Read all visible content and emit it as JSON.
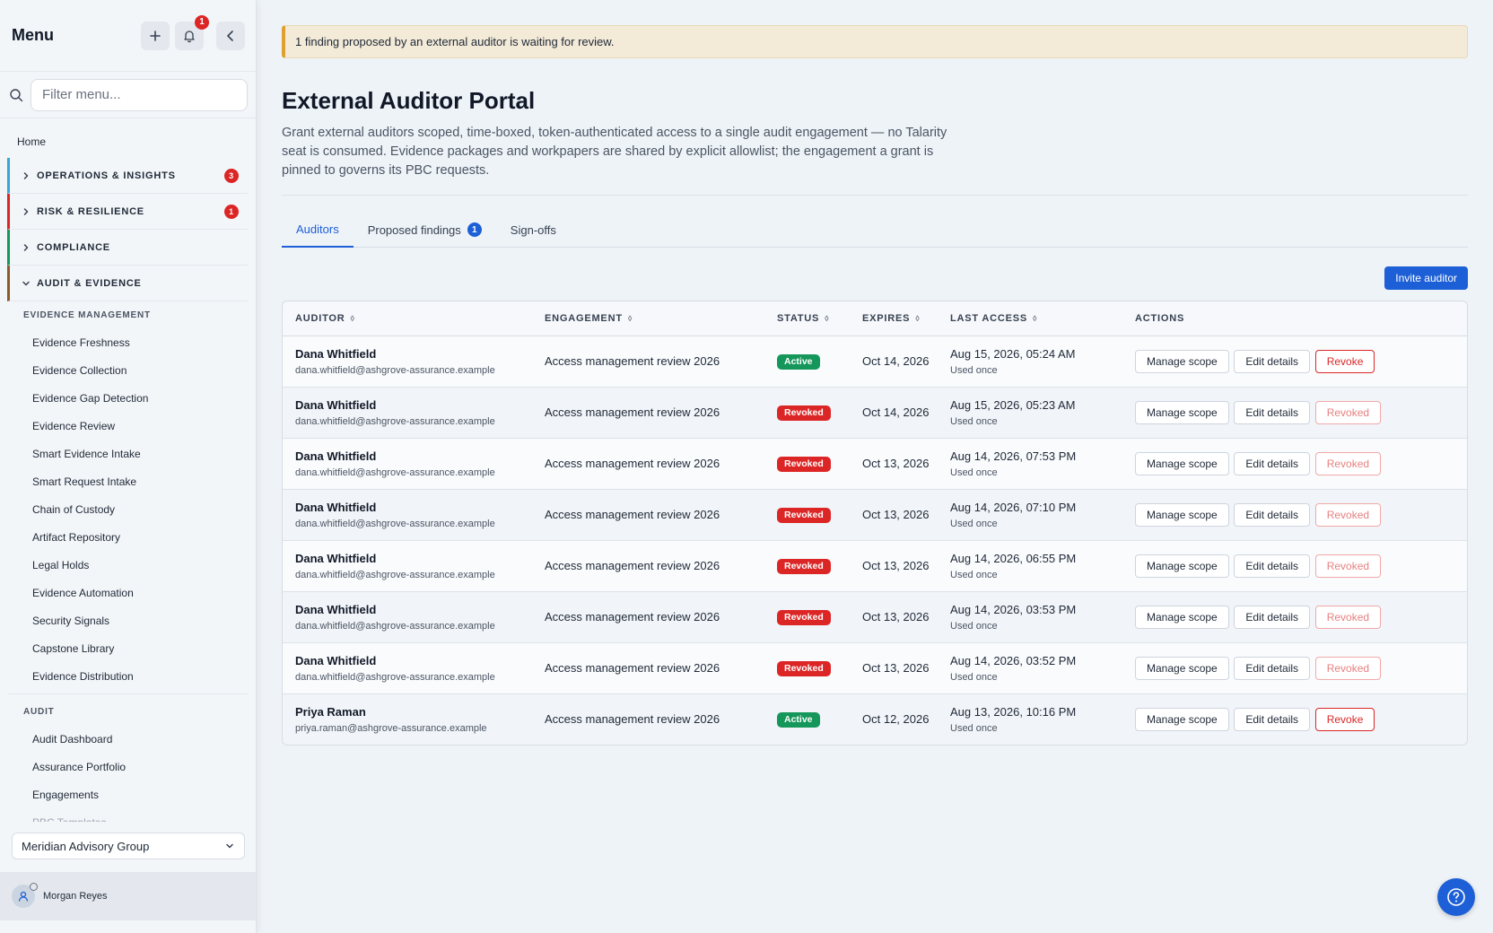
{
  "sidebar": {
    "title": "Menu",
    "notification_count": "1",
    "filter_placeholder": "Filter menu...",
    "home": "Home",
    "sections": [
      {
        "label": "OPERATIONS & INSIGHTS",
        "badge": "3",
        "color": "#38a7d8"
      },
      {
        "label": "RISK & RESILIENCE",
        "badge": "1",
        "color": "#dc2626"
      },
      {
        "label": "COMPLIANCE",
        "badge": "",
        "color": "#15965a"
      },
      {
        "label": "AUDIT & EVIDENCE",
        "badge": "",
        "color": "#8b5a2b"
      }
    ],
    "groups": [
      {
        "label": "EVIDENCE MANAGEMENT",
        "items": [
          "Evidence Freshness",
          "Evidence Collection",
          "Evidence Gap Detection",
          "Evidence Review",
          "Smart Evidence Intake",
          "Smart Request Intake",
          "Chain of Custody",
          "Artifact Repository",
          "Legal Holds",
          "Evidence Automation",
          "Security Signals",
          "Capstone Library",
          "Evidence Distribution"
        ]
      },
      {
        "label": "AUDIT",
        "items": [
          "Audit Dashboard",
          "Assurance Portfolio",
          "Engagements",
          "PBC Templates"
        ]
      }
    ],
    "org": "Meridian Advisory Group",
    "user": "Morgan Reyes"
  },
  "banner": "1 finding proposed by an external auditor is waiting for review.",
  "page": {
    "title": "External Auditor Portal",
    "description": "Grant external auditors scoped, time-boxed, token-authenticated access to a single audit engagement — no Talarity seat is consumed. Evidence packages and workpapers are shared by explicit allowlist; the engagement a grant is pinned to governs its PBC requests."
  },
  "tabs": [
    {
      "label": "Auditors",
      "badge": ""
    },
    {
      "label": "Proposed findings",
      "badge": "1"
    },
    {
      "label": "Sign-offs",
      "badge": ""
    }
  ],
  "toolbar": {
    "invite_label": "Invite auditor"
  },
  "table": {
    "columns": [
      "AUDITOR",
      "ENGAGEMENT",
      "STATUS",
      "EXPIRES",
      "LAST ACCESS",
      "ACTIONS"
    ],
    "actions": {
      "manage": "Manage scope",
      "edit": "Edit details",
      "revoke": "Revoke",
      "revoked": "Revoked"
    },
    "rows": [
      {
        "name": "Dana Whitfield",
        "email": "dana.whitfield@ashgrove-assurance.example",
        "engagement": "Access management review 2026",
        "status": "Active",
        "expires": "Oct 14, 2026",
        "last_access": "Aug 15, 2026, 05:24 AM",
        "note": "Used once"
      },
      {
        "name": "Dana Whitfield",
        "email": "dana.whitfield@ashgrove-assurance.example",
        "engagement": "Access management review 2026",
        "status": "Revoked",
        "expires": "Oct 14, 2026",
        "last_access": "Aug 15, 2026, 05:23 AM",
        "note": "Used once"
      },
      {
        "name": "Dana Whitfield",
        "email": "dana.whitfield@ashgrove-assurance.example",
        "engagement": "Access management review 2026",
        "status": "Revoked",
        "expires": "Oct 13, 2026",
        "last_access": "Aug 14, 2026, 07:53 PM",
        "note": "Used once"
      },
      {
        "name": "Dana Whitfield",
        "email": "dana.whitfield@ashgrove-assurance.example",
        "engagement": "Access management review 2026",
        "status": "Revoked",
        "expires": "Oct 13, 2026",
        "last_access": "Aug 14, 2026, 07:10 PM",
        "note": "Used once"
      },
      {
        "name": "Dana Whitfield",
        "email": "dana.whitfield@ashgrove-assurance.example",
        "engagement": "Access management review 2026",
        "status": "Revoked",
        "expires": "Oct 13, 2026",
        "last_access": "Aug 14, 2026, 06:55 PM",
        "note": "Used once"
      },
      {
        "name": "Dana Whitfield",
        "email": "dana.whitfield@ashgrove-assurance.example",
        "engagement": "Access management review 2026",
        "status": "Revoked",
        "expires": "Oct 13, 2026",
        "last_access": "Aug 14, 2026, 03:53 PM",
        "note": "Used once"
      },
      {
        "name": "Dana Whitfield",
        "email": "dana.whitfield@ashgrove-assurance.example",
        "engagement": "Access management review 2026",
        "status": "Revoked",
        "expires": "Oct 13, 2026",
        "last_access": "Aug 14, 2026, 03:52 PM",
        "note": "Used once"
      },
      {
        "name": "Priya Raman",
        "email": "priya.raman@ashgrove-assurance.example",
        "engagement": "Access management review 2026",
        "status": "Active",
        "expires": "Oct 12, 2026",
        "last_access": "Aug 13, 2026, 10:16 PM",
        "note": "Used once"
      }
    ]
  },
  "icons": {
    "add": "plus-icon",
    "bell": "bell-icon",
    "collapse": "chevron-left-icon",
    "search": "search-icon",
    "section": "chevron-right-icon",
    "org": "chevron-down-icon",
    "user": "user-icon",
    "help": "help-icon",
    "sort": "sort-icon"
  },
  "colors": {
    "accent": "#1d5fd6",
    "active": "#15965a",
    "danger": "#dc2626",
    "banner": "#e0a030"
  }
}
